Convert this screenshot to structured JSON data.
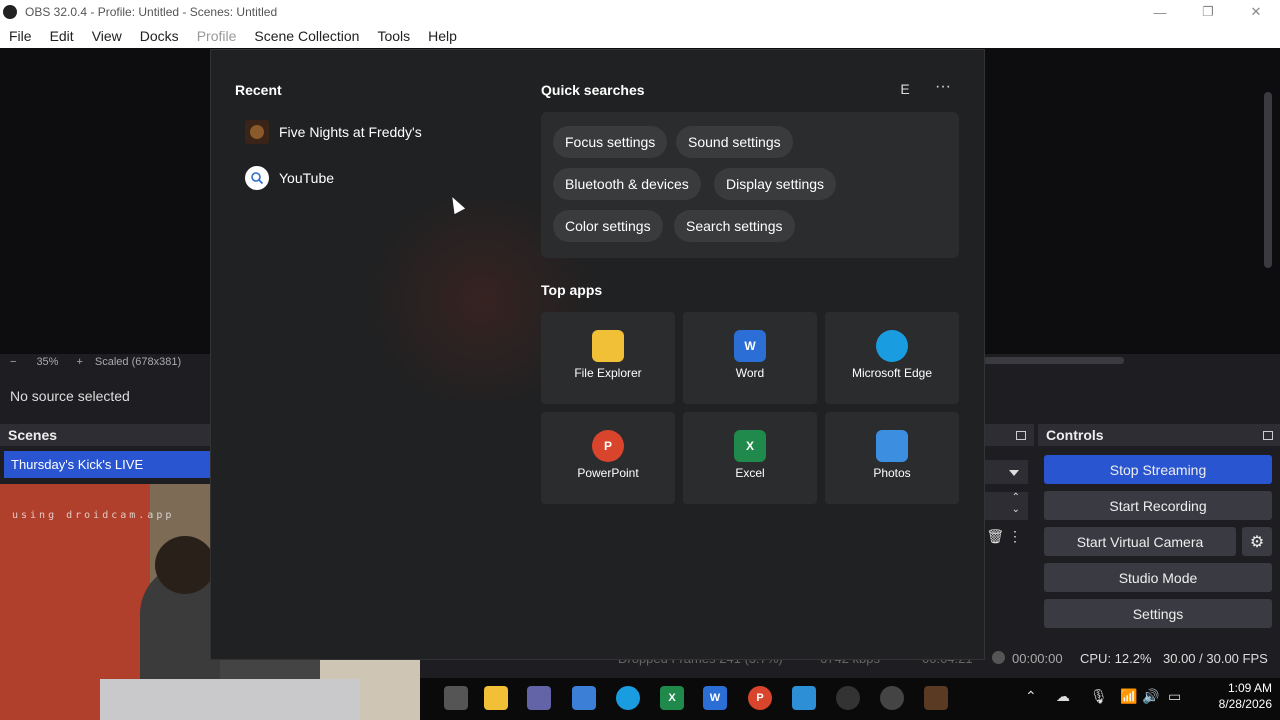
{
  "titlebar": {
    "title": "OBS 32.0.4 - Profile: Untitled - Scenes: Untitled"
  },
  "menubar": {
    "items": [
      "File",
      "Edit",
      "View",
      "Docks",
      "Profile",
      "Scene Collection",
      "Tools",
      "Help"
    ]
  },
  "preview": {
    "zoom_level": "35%",
    "scale_label": "Scaled (678x381)"
  },
  "source": {
    "status": "No source selected"
  },
  "scenes": {
    "title": "Scenes",
    "items": [
      "Thursday's Kick's LIVE"
    ]
  },
  "controls": {
    "title": "Controls",
    "stop_streaming": "Stop Streaming",
    "start_recording": "Start Recording",
    "start_virtual_camera": "Start Virtual Camera",
    "studio_mode": "Studio Mode",
    "settings": "Settings"
  },
  "statusbar": {
    "dropped_frames": "Dropped Frames 241 (3.7%)",
    "bitrate": "6742 kbps",
    "stream_time": "00:04:21",
    "rec_time": "00:00:00",
    "cpu": "CPU: 12.2%",
    "fps": "30.00 / 30.00 FPS"
  },
  "webcam": {
    "watermark": "using droidcam.app"
  },
  "start_menu": {
    "recent_title": "Recent",
    "recent": [
      "Five Nights at Freddy's",
      "YouTube"
    ],
    "quick_title": "Quick searches",
    "quick": [
      "Focus settings",
      "Sound settings",
      "Bluetooth & devices",
      "Display settings",
      "Color settings",
      "Search settings"
    ],
    "user_initial": "E",
    "more": "···",
    "top_apps_title": "Top apps",
    "apps": [
      "File Explorer",
      "Word",
      "Microsoft Edge",
      "PowerPoint",
      "Excel",
      "Photos"
    ]
  },
  "taskbar": {
    "time": "1:09 AM",
    "date": "8/28/2026"
  },
  "colors": {
    "accent": "#2a55d0",
    "menu_bg": "#202122",
    "tile_bg": "#2b2c2e"
  }
}
